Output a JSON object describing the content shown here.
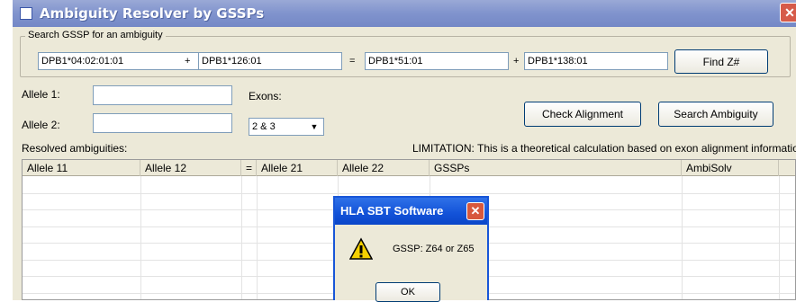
{
  "window": {
    "title": "Ambiguity Resolver by GSSPs",
    "close_glyph": "✕"
  },
  "search": {
    "legend": "Search GSSP for an ambiguity",
    "field1": "DPB1*04:02:01:01",
    "plus1": "+",
    "field2": "DPB1*126:01",
    "equals": "=",
    "field3": "DPB1*51:01",
    "plus2": "+",
    "field4": "DPB1*138:01",
    "find_button": "Find Z#"
  },
  "alleles": {
    "allele1_label": "Allele 1:",
    "allele1_value": "",
    "allele2_label": "Allele 2:",
    "allele2_value": "",
    "exons_label": "Exons:",
    "exons_value": "2 & 3"
  },
  "buttons": {
    "check_alignment": "Check Alignment",
    "search_ambiguity": "Search Ambiguity"
  },
  "results": {
    "label": "Resolved ambiguities:",
    "limitation": "LIMITATION: This is a theoretical calculation based on exon alignment information.",
    "columns": [
      "Allele 11",
      "Allele 12",
      "=",
      "Allele 21",
      "Allele 22",
      "GSSPs",
      "AmbiSolv"
    ]
  },
  "dialog": {
    "title": "HLA SBT Software",
    "message": "GSSP: Z64 or Z65",
    "ok": "OK",
    "icon": "warning-icon"
  },
  "colors": {
    "title_bar": "#8093cd",
    "dialog_title": "#1252d8",
    "face": "#ece9d8"
  }
}
